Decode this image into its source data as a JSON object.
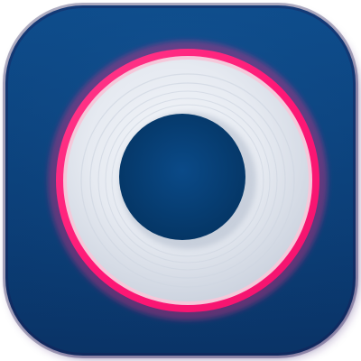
{
  "icon": {
    "name": "ring-app-icon",
    "colors": {
      "background_top": "#0d4a86",
      "background_bottom": "#0a3468",
      "rim_shadow": "#2a1b5c",
      "ring_outer": "#ff1f7a",
      "ring_inner": "#f4c7da",
      "disc_light": "#eef1f6",
      "disc_mid": "#dfe4ec",
      "disc_edge": "#c8cfdb",
      "hole": "#063c72"
    }
  }
}
